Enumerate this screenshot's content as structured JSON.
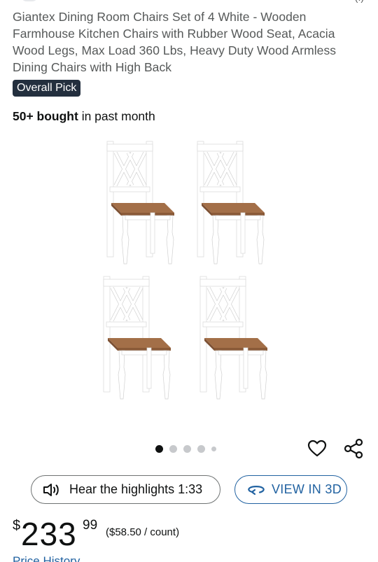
{
  "product": {
    "title": "Giantex Dining Room Chairs Set of 4 White - Wooden Farmhouse Kitchen Chairs with Rubber Wood Seat, Acacia Wood Legs, Max Load 360 Lbs, Heavy Duty Wood Armless Dining Chairs with High Back",
    "badge": "Overall Pick",
    "bought_count": "50+ bought",
    "bought_suffix": " in past month"
  },
  "gallery": {
    "image_icon": "chair-set-image",
    "dot_count": 5,
    "active_index": 0
  },
  "actions": {
    "favorite_icon": "heart-icon",
    "share_icon": "share-icon"
  },
  "audio": {
    "label": "Hear the highlights 1:33",
    "icon": "speaker-icon"
  },
  "view3d": {
    "label": "VIEW IN 3D",
    "icon": "rotate-3d-icon"
  },
  "price": {
    "symbol": "$",
    "whole": "233",
    "fraction": "99",
    "per_unit": "($58.50 / count)"
  },
  "links": {
    "price_history": "Price History"
  },
  "colors": {
    "badge_bg": "#232f3e",
    "link_blue": "#2162a1",
    "seat_wood": "#9c6b47",
    "chair_white": "#ffffff"
  }
}
